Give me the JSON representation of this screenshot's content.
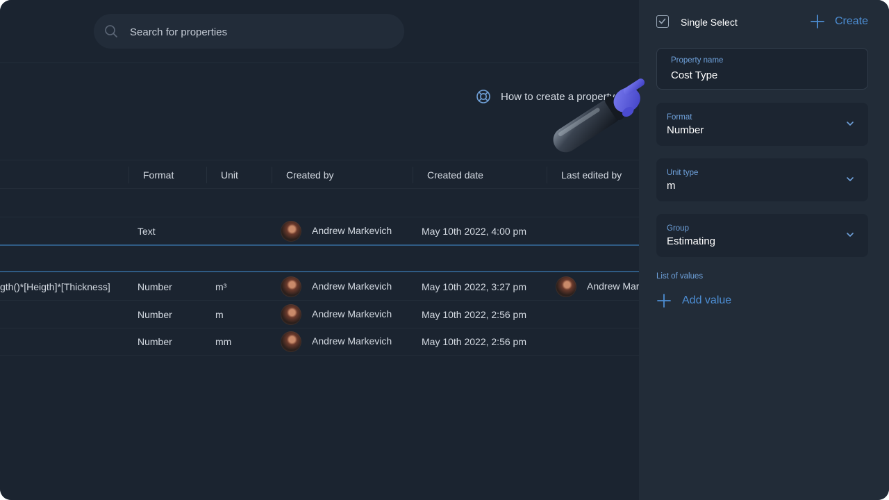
{
  "search": {
    "placeholder": "Search for properties",
    "icon": "search-icon"
  },
  "help": {
    "label": "How to create a property",
    "icon": "lifebuoy-icon"
  },
  "table": {
    "columns": [
      "Format",
      "Unit",
      "Created by",
      "Created date",
      "Last edited by"
    ],
    "rows": [
      {
        "formula": "",
        "format": "Text",
        "unit": "",
        "created_by": "Andrew Markevich",
        "created_date": "May 10th 2022, 4:00 pm",
        "last_edited_by": ""
      },
      {
        "formula": "gth()*[Heigth]*[Thickness]",
        "format": "Number",
        "unit": "m³",
        "created_by": "Andrew Markevich",
        "created_date": "May 10th 2022, 3:27 pm",
        "last_edited_by": "Andrew Mar"
      },
      {
        "formula": "",
        "format": "Number",
        "unit": "m",
        "created_by": "Andrew Markevich",
        "created_date": "May 10th 2022, 2:56 pm",
        "last_edited_by": ""
      },
      {
        "formula": "",
        "format": "Number",
        "unit": "mm",
        "created_by": "Andrew Markevich",
        "created_date": "May 10th 2022, 2:56 pm",
        "last_edited_by": ""
      }
    ]
  },
  "panel": {
    "type_label": "Single Select",
    "create_label": "Create",
    "property_name": {
      "label": "Property name",
      "value": "Cost Type"
    },
    "format": {
      "label": "Format",
      "value": "Number"
    },
    "unit_type": {
      "label": "Unit type",
      "value": "m"
    },
    "group": {
      "label": "Group",
      "value": "Estimating"
    },
    "list_label": "List of values",
    "add_value_label": "Add value"
  },
  "colors": {
    "background": "#1b2430",
    "panel": "#222c38",
    "accent": "#4d8ed4",
    "label": "#6fa2dc",
    "row_separator": "#2f5b84"
  }
}
